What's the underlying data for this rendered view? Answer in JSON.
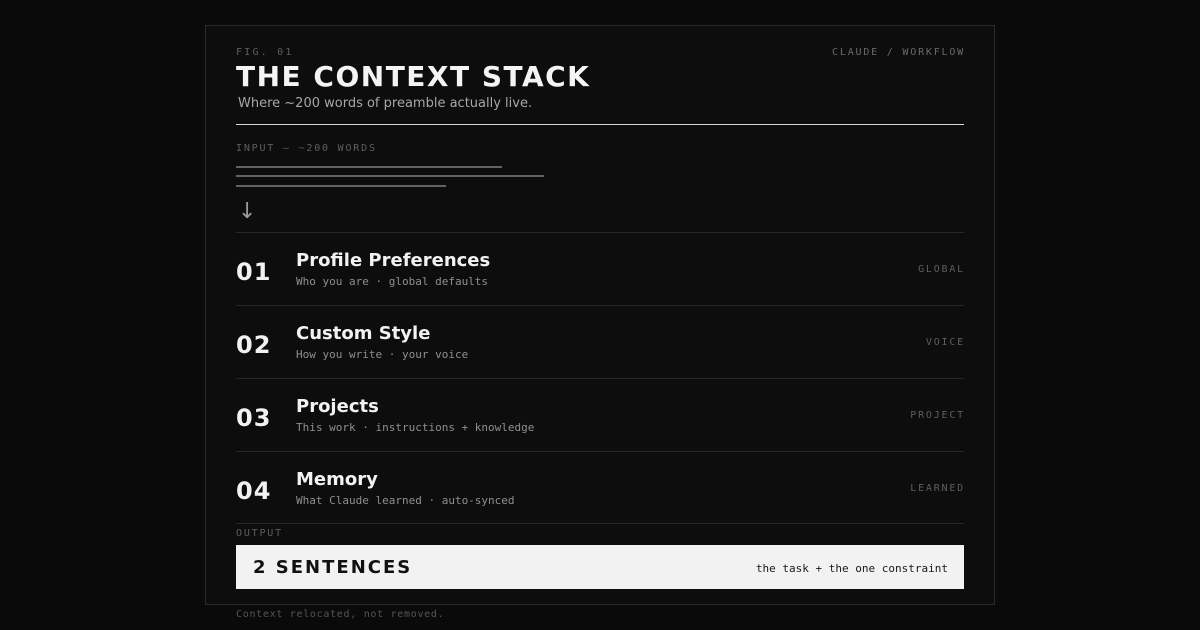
{
  "header": {
    "figure_label": "FIG. 01",
    "brand_label": "CLAUDE / WORKFLOW",
    "title": "THE CONTEXT STACK",
    "subtitle": "Where ~200 words of preamble actually live."
  },
  "input": {
    "label": "INPUT — ~200 WORDS",
    "arrow": "↓"
  },
  "stack": [
    {
      "number": "01",
      "title": "Profile Preferences",
      "description": "Who you are · global defaults",
      "tag": "GLOBAL"
    },
    {
      "number": "02",
      "title": "Custom Style",
      "description": "How you write · your voice",
      "tag": "VOICE"
    },
    {
      "number": "03",
      "title": "Projects",
      "description": "This work · instructions + knowledge",
      "tag": "PROJECT"
    },
    {
      "number": "04",
      "title": "Memory",
      "description": "What Claude learned · auto-synced",
      "tag": "LEARNED"
    }
  ],
  "output": {
    "label": "OUTPUT",
    "result": "2 SENTENCES",
    "detail": "the task + the one constraint"
  },
  "footer": {
    "caption": "Context relocated, not removed."
  },
  "colors": {
    "background": "#0a0a0a",
    "frame": "#0d0d0d",
    "output_background": "#f2f2f2"
  }
}
